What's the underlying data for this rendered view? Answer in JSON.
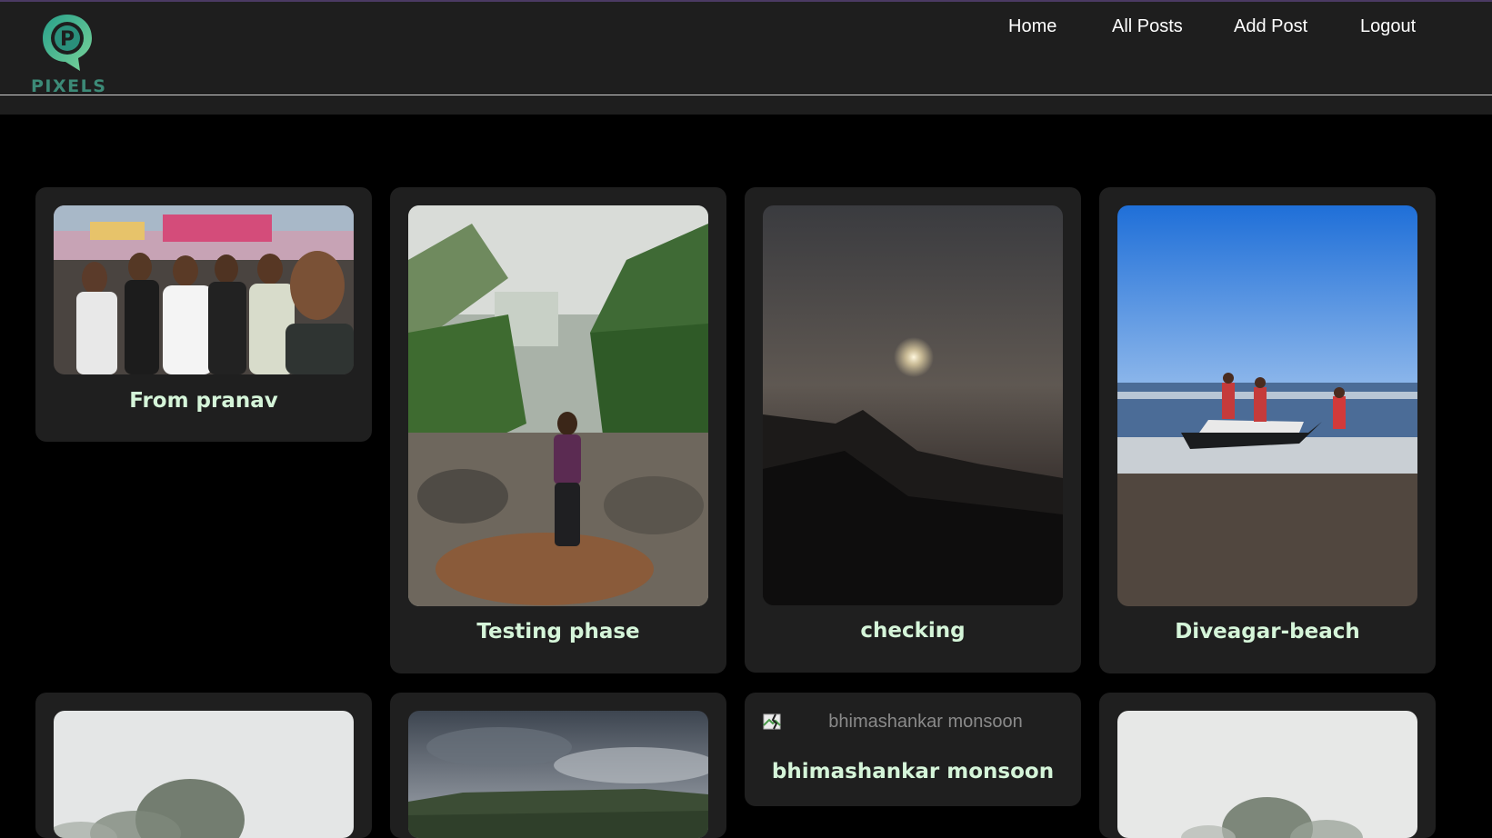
{
  "brand": {
    "logo_letter": "P",
    "logo_text": "PIXELS"
  },
  "nav": {
    "home": "Home",
    "all_posts": "All Posts",
    "add_post": "Add Post",
    "logout": "Logout"
  },
  "posts": [
    {
      "title": "From pranav"
    },
    {
      "title": "Testing phase"
    },
    {
      "title": "checking"
    },
    {
      "title": "Diveagar-beach"
    },
    {
      "title": ""
    },
    {
      "title": ""
    },
    {
      "title": "bhimashankar monsoon",
      "image_alt": "bhimashankar monsoon"
    },
    {
      "title": ""
    }
  ],
  "colors": {
    "header_bg": "#1e1e1e",
    "card_bg": "#1f1f1f",
    "title_color": "#d5f5d9",
    "logo_green": "#3c8a77"
  }
}
